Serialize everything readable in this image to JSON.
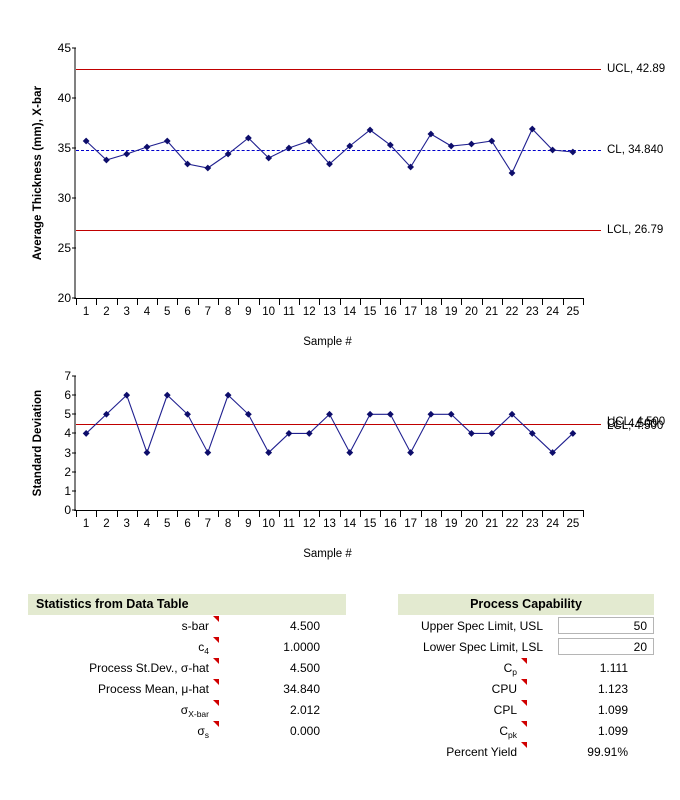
{
  "chart_data": [
    {
      "type": "line",
      "name": "xbar-chart",
      "title": "",
      "ylabel": "Average Thickness (mm), X-bar",
      "xlabel": "Sample #",
      "categories": [
        1,
        2,
        3,
        4,
        5,
        6,
        7,
        8,
        9,
        10,
        11,
        12,
        13,
        14,
        15,
        16,
        17,
        18,
        19,
        20,
        21,
        22,
        23,
        24,
        25
      ],
      "values": [
        35.7,
        33.8,
        34.4,
        35.1,
        35.7,
        33.4,
        33.0,
        34.4,
        36.0,
        34.0,
        35.0,
        35.7,
        33.4,
        35.2,
        36.8,
        35.3,
        33.1,
        36.4,
        35.2,
        35.4,
        35.7,
        32.5,
        36.9,
        34.8,
        34.6
      ],
      "ylim": [
        20,
        45
      ],
      "yticks": [
        20,
        25,
        30,
        35,
        40,
        45
      ],
      "grid": false,
      "lines": [
        {
          "id": "ucl",
          "label": "UCL, 42.89",
          "value": 42.89,
          "color": "#c00000",
          "style": "solid"
        },
        {
          "id": "cl",
          "label": "CL, 34.840",
          "value": 34.84,
          "color": "#0000cc",
          "style": "dashed"
        },
        {
          "id": "lcl",
          "label": "LCL, 26.79",
          "value": 26.79,
          "color": "#c00000",
          "style": "solid"
        }
      ],
      "series_color": "#1f1f8f",
      "marker_color": "#0d0d6b"
    },
    {
      "type": "line",
      "name": "s-chart",
      "title": "",
      "ylabel": "Standard Deviation",
      "xlabel": "Sample #",
      "categories": [
        1,
        2,
        3,
        4,
        5,
        6,
        7,
        8,
        9,
        10,
        11,
        12,
        13,
        14,
        15,
        16,
        17,
        18,
        19,
        20,
        21,
        22,
        23,
        24,
        25
      ],
      "values": [
        4,
        5,
        6,
        3,
        6,
        5,
        3,
        6,
        5,
        3,
        4,
        4,
        5,
        3,
        5,
        5,
        3,
        5,
        5,
        4,
        4,
        5,
        4,
        3,
        4
      ],
      "ylim": [
        0,
        7
      ],
      "yticks": [
        0,
        1,
        2,
        3,
        4,
        5,
        6,
        7
      ],
      "grid": false,
      "lines": [
        {
          "id": "ucl",
          "label": "UCL, 4.500",
          "value": 4.5,
          "color": "#c00000",
          "style": "solid"
        },
        {
          "id": "cl",
          "label": "CL, 4.500",
          "value": 4.5,
          "color": "#c00000",
          "style": "solid"
        },
        {
          "id": "lcl",
          "label": "LCL, 4.500",
          "value": 4.5,
          "color": "#c00000",
          "style": "solid"
        }
      ],
      "series_color": "#1f1f8f",
      "marker_color": "#0d0d6b"
    }
  ],
  "stats_table": {
    "header": "Statistics from Data Table",
    "rows": [
      {
        "label": "s-bar",
        "value": "4.500"
      },
      {
        "label": "c₄",
        "value": "1.0000"
      },
      {
        "label": "Process St.Dev., σ-hat",
        "value": "4.500"
      },
      {
        "label": "Process Mean, μ-hat",
        "value": "34.840"
      },
      {
        "label": "σX-bar",
        "value": "2.012"
      },
      {
        "label": "σs",
        "value": "0.000"
      }
    ]
  },
  "capability_table": {
    "header": "Process Capability",
    "rows": [
      {
        "label": "Upper Spec Limit, USL",
        "value": "50",
        "boxed": true
      },
      {
        "label": "Lower Spec Limit, LSL",
        "value": "20",
        "boxed": true
      },
      {
        "label": "Cp",
        "value": "1.111",
        "boxed": false
      },
      {
        "label": "CPU",
        "value": "1.123",
        "boxed": false
      },
      {
        "label": "CPL",
        "value": "1.099",
        "boxed": false
      },
      {
        "label": "Cpk",
        "value": "1.099",
        "boxed": false
      },
      {
        "label": "Percent Yield",
        "value": "99.91%",
        "boxed": false
      }
    ]
  },
  "colors": {
    "limit_red": "#c00000",
    "center_blue": "#0000cc",
    "series_navy": "#1f1f8f",
    "header_green": "#e3ead0"
  }
}
